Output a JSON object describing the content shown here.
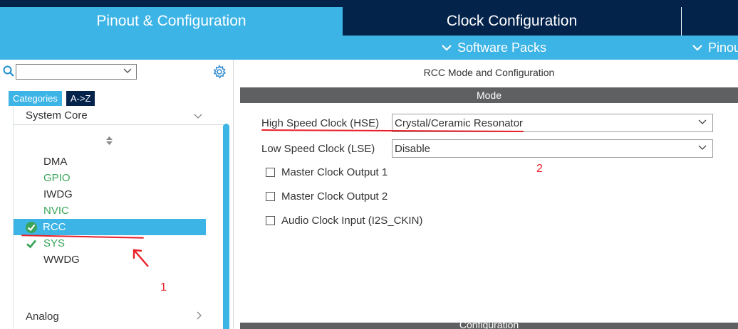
{
  "tabs": {
    "pinout": "Pinout & Configuration",
    "clock": "Clock Configuration"
  },
  "subbar": {
    "software_packs": "Software Packs",
    "pinout": "Pinout"
  },
  "sidebar": {
    "search_value": "",
    "category_tabs": [
      "Categories",
      "A->Z"
    ],
    "groups": {
      "system_core": "System Core",
      "analog": "Analog"
    },
    "items": {
      "dma": "DMA",
      "gpio": "GPIO",
      "iwdg": "IWDG",
      "nvic": "NVIC",
      "rcc": "RCC",
      "sys": "SYS",
      "wwdg": "WWDG"
    }
  },
  "main": {
    "title": "RCC Mode and Configuration",
    "mode_header": "Mode",
    "config_header": "Configuration",
    "hse": {
      "label": "High Speed Clock (HSE)",
      "value": "Crystal/Ceramic Resonator"
    },
    "lse": {
      "label": "Low Speed Clock (LSE)",
      "value": "Disable"
    },
    "checkboxes": {
      "mco1": "Master Clock Output 1",
      "mco2": "Master Clock Output 2",
      "i2s": "Audio Clock Input (I2S_CKIN)"
    }
  },
  "annotations": {
    "marker_1": "1",
    "marker_2": "2"
  },
  "colors": {
    "accent": "#3cb4e6",
    "navy": "#03234b",
    "green": "#3aa55a",
    "annotation_red": "#e8202a",
    "section_bar": "#5f6061"
  }
}
